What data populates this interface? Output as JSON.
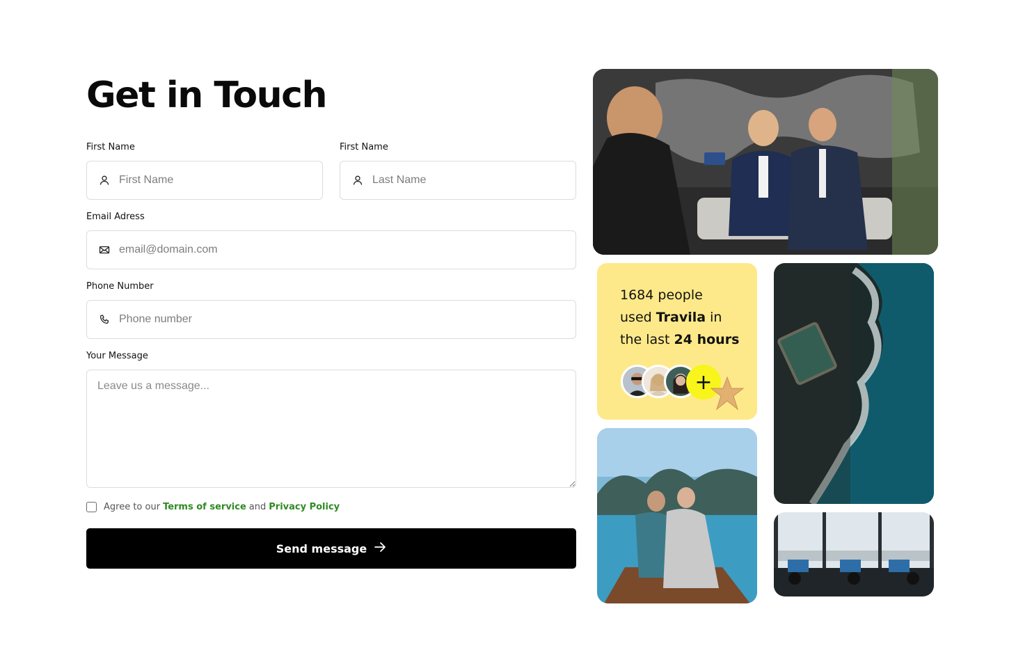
{
  "heading": "Get in Touch",
  "form": {
    "first_name_label": "First Name",
    "first_name_placeholder": "First Name",
    "last_name_label": "First Name",
    "last_name_placeholder": "Last Name",
    "email_label": "Email Adress",
    "email_placeholder": "email@domain.com",
    "phone_label": "Phone Number",
    "phone_placeholder": "Phone number",
    "message_label": "Your Message",
    "message_placeholder": "Leave us a message...",
    "agree_prefix": "Agree to our",
    "terms_link": "Terms of service",
    "agree_and": "and",
    "privacy_link": "Privacy Policy",
    "submit_label": "Send message"
  },
  "stat_card": {
    "line1": "1684 people",
    "line2_prefix": "used",
    "brand": "Travila",
    "line2_suffix": "in",
    "line3_prefix": "the last",
    "period": "24 hours",
    "plus_symbol": "+"
  },
  "colors": {
    "accent_link": "#2e8b22",
    "card_bg": "#fde98a",
    "plus_bg": "#f7f51b",
    "button_bg": "#000000"
  },
  "icons": [
    "user-icon",
    "mail-icon",
    "phone-icon",
    "arrow-right-icon",
    "plus-icon",
    "starfish-icon"
  ]
}
